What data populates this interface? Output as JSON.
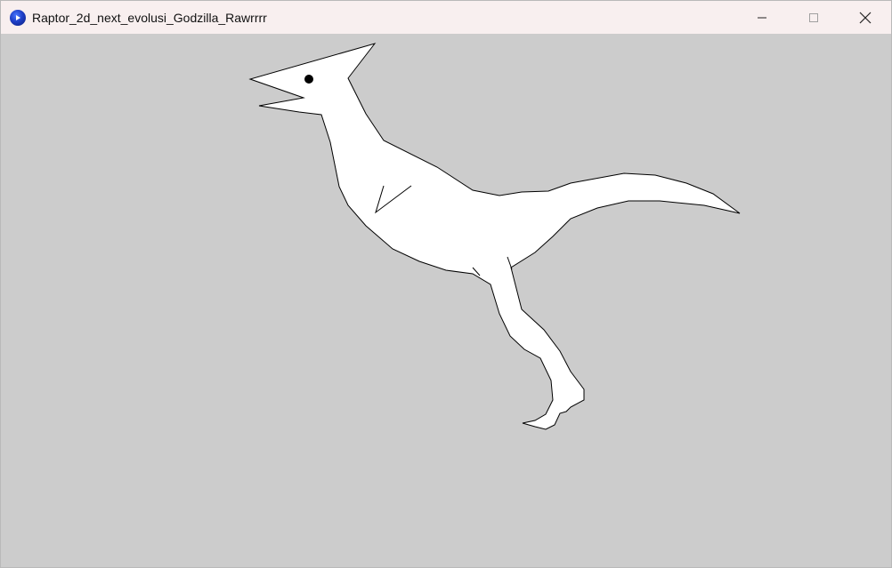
{
  "window": {
    "title": "Raptor_2d_next_evolusi_Godzilla_Rawrrrr",
    "icon": "processing-app-icon",
    "controls": {
      "minimize_icon": "minimize-icon",
      "maximize_icon": "maximize-icon",
      "close_icon": "close-icon"
    }
  },
  "canvas": {
    "background_color": "#cccccc",
    "figure": {
      "subject": "raptor",
      "fill_color": "#ffffff",
      "stroke_color": "#000000",
      "eye_color": "#000000"
    }
  }
}
